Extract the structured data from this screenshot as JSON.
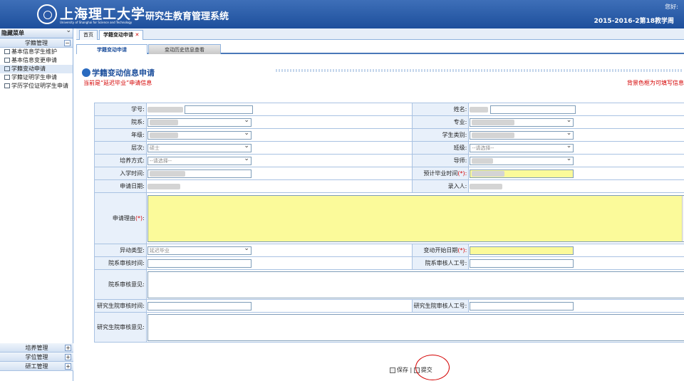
{
  "header": {
    "uni_cn": "上海理工大学",
    "uni_en": "University of Shanghai for Science and Technology",
    "system": "研究生教育管理系统",
    "greeting": "您好:",
    "week": "2015-2016-2第18教学周"
  },
  "sidebar": {
    "title": "隐藏菜单",
    "section": "学籍管理",
    "items": [
      "基本信息学生维护",
      "基本信息变更申请",
      "学籍变动申请",
      "学籍证明学生申请",
      "学历学位证明学生申请"
    ],
    "bottom": [
      "培养管理",
      "学位管理",
      "研工管理"
    ]
  },
  "tabs": {
    "home": "首页",
    "current": "学籍变动申请"
  },
  "subtabs": {
    "apply": "学籍变动申请",
    "history": "变动历史信息查看"
  },
  "title": "学籍变动信息申请",
  "notice": "当前是“延迟毕业”申请信息",
  "notice_right": "背景色框为可填写信息",
  "labels": {
    "sno": "学号:",
    "name": "姓名:",
    "dept": "院系:",
    "major": "专业:",
    "grade": "年级:",
    "stype": "学生类别:",
    "level": "层次:",
    "class": "班级:",
    "train": "培养方式:",
    "tutor": "导师:",
    "enroll": "入学时间:",
    "expect": "预计毕业时间",
    "apply": "申请日期:",
    "entry": "录入人:",
    "reason": "申请理由",
    "change_type": "异动类型:",
    "change_date": "变动开始日期",
    "dept_time": "院系审核时间:",
    "dept_staff": "院系审核人工号:",
    "dept_opinion": "院系审核意见:",
    "gs_time": "研究生院审核时间:",
    "gs_staff": "研究生院审核人工号:",
    "gs_opinion": "研究生院审核意见:"
  },
  "values": {
    "level": "硕士",
    "class_ph": "--请选择--",
    "train_ph": "--请选择--",
    "change_type": "延迟毕业"
  },
  "buttons": {
    "save": "保存",
    "submit": "提交"
  }
}
